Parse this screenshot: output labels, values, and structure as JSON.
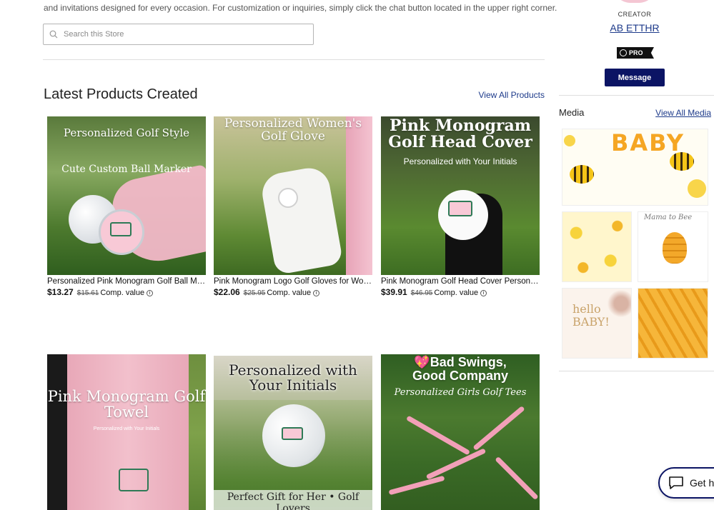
{
  "store": {
    "intro": "and invitations designed for every occasion. For customization or inquiries, simply click the chat button located in the upper right corner.",
    "search_placeholder": "Search this Store"
  },
  "latest": {
    "title": "Latest Products Created",
    "view_all": "View All Products",
    "comp_label": "Comp. value",
    "products": [
      {
        "name": "Personalized Pink Monogram Golf Ball Marker",
        "price": "$13.27",
        "comp": "$15.61",
        "img_title": "Personalized Golf Style",
        "img_sub": "Cute Custom Ball Marker"
      },
      {
        "name": "Pink Monogram Logo Golf Gloves for Women",
        "price": "$22.06",
        "comp": "$25.95",
        "img_title": "Personalized Women's Golf Glove",
        "img_sub": ""
      },
      {
        "name": "Pink Monogram Golf Head Cover Personalized",
        "price": "$39.91",
        "comp": "$46.95",
        "img_title": "Pink Monogram Golf Head Cover",
        "img_sub": "Personalized with Your Initials"
      },
      {
        "name": "",
        "price": "",
        "comp": "",
        "img_title": "Pink Monogram Golf Towel",
        "img_sub": "Personalized with Your Initials"
      },
      {
        "name": "",
        "price": "",
        "comp": "",
        "img_title": "Personalized with Your Initials",
        "img_sub": "Perfect Gift for Her • Golf Lovers"
      },
      {
        "name": "",
        "price": "",
        "comp": "",
        "img_title": "💖Bad Swings, Good Company",
        "img_sub": "Personalized Girls Golf Tees"
      }
    ]
  },
  "creator": {
    "label": "CREATOR",
    "name": "AB ETTHR",
    "badge": "PRO",
    "message_label": "Message"
  },
  "media": {
    "title": "Media",
    "view_all": "View All Media",
    "items": [
      {
        "text": "BABY"
      },
      {
        "text": ""
      },
      {
        "text": "Mama to Bee"
      },
      {
        "text": "hello BABY!"
      },
      {
        "text": ""
      }
    ]
  },
  "chat": {
    "label": "Get help"
  },
  "colors": {
    "link": "#1d3a8a",
    "button": "#0b1464",
    "pink": "#f4c6d3",
    "bee_yellow": "#f5b91e"
  }
}
